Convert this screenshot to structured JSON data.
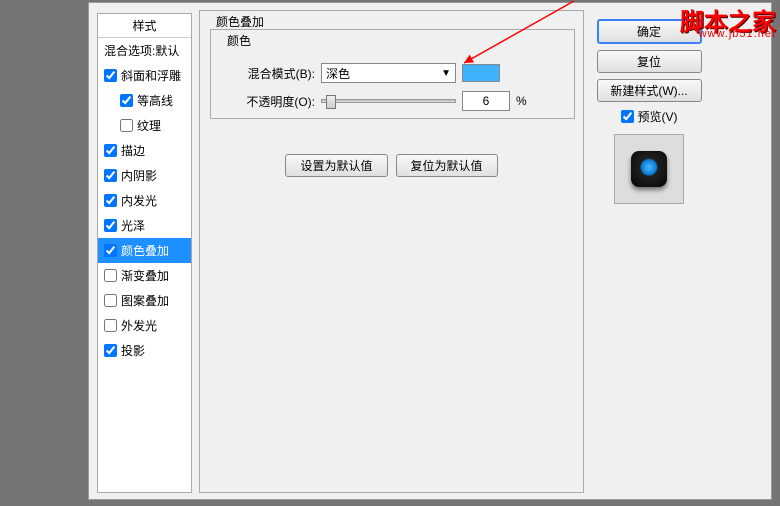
{
  "stylesPanel": {
    "header": "样式",
    "items": [
      {
        "label": "混合选项:默认",
        "checked": false,
        "nocheckbox": true
      },
      {
        "label": "斜面和浮雕",
        "checked": true
      },
      {
        "label": "等高线",
        "checked": true,
        "indent": true
      },
      {
        "label": "纹理",
        "checked": false,
        "indent": true
      },
      {
        "label": "描边",
        "checked": true
      },
      {
        "label": "内阴影",
        "checked": true
      },
      {
        "label": "内发光",
        "checked": true
      },
      {
        "label": "光泽",
        "checked": true
      },
      {
        "label": "颜色叠加",
        "checked": true,
        "selected": true
      },
      {
        "label": "渐变叠加",
        "checked": false
      },
      {
        "label": "图案叠加",
        "checked": false
      },
      {
        "label": "外发光",
        "checked": false
      },
      {
        "label": "投影",
        "checked": true
      }
    ]
  },
  "main": {
    "groupTitle": "颜色叠加",
    "colorGroup": "颜色",
    "blendModeLabel": "混合模式(B):",
    "blendModeValue": "深色",
    "swatchColor": "#3eb2ff",
    "opacityLabel": "不透明度(O):",
    "opacityValue": "6",
    "opacityUnit": "%",
    "setDefaultBtn": "设置为默认值",
    "resetDefaultBtn": "复位为默认值"
  },
  "right": {
    "ok": "确定",
    "cancel": "复位",
    "newStyle": "新建样式(W)...",
    "previewLabel": "预览(V)",
    "previewChecked": true
  },
  "watermark": {
    "title": "脚本之家",
    "url": "www.jb51.net"
  }
}
